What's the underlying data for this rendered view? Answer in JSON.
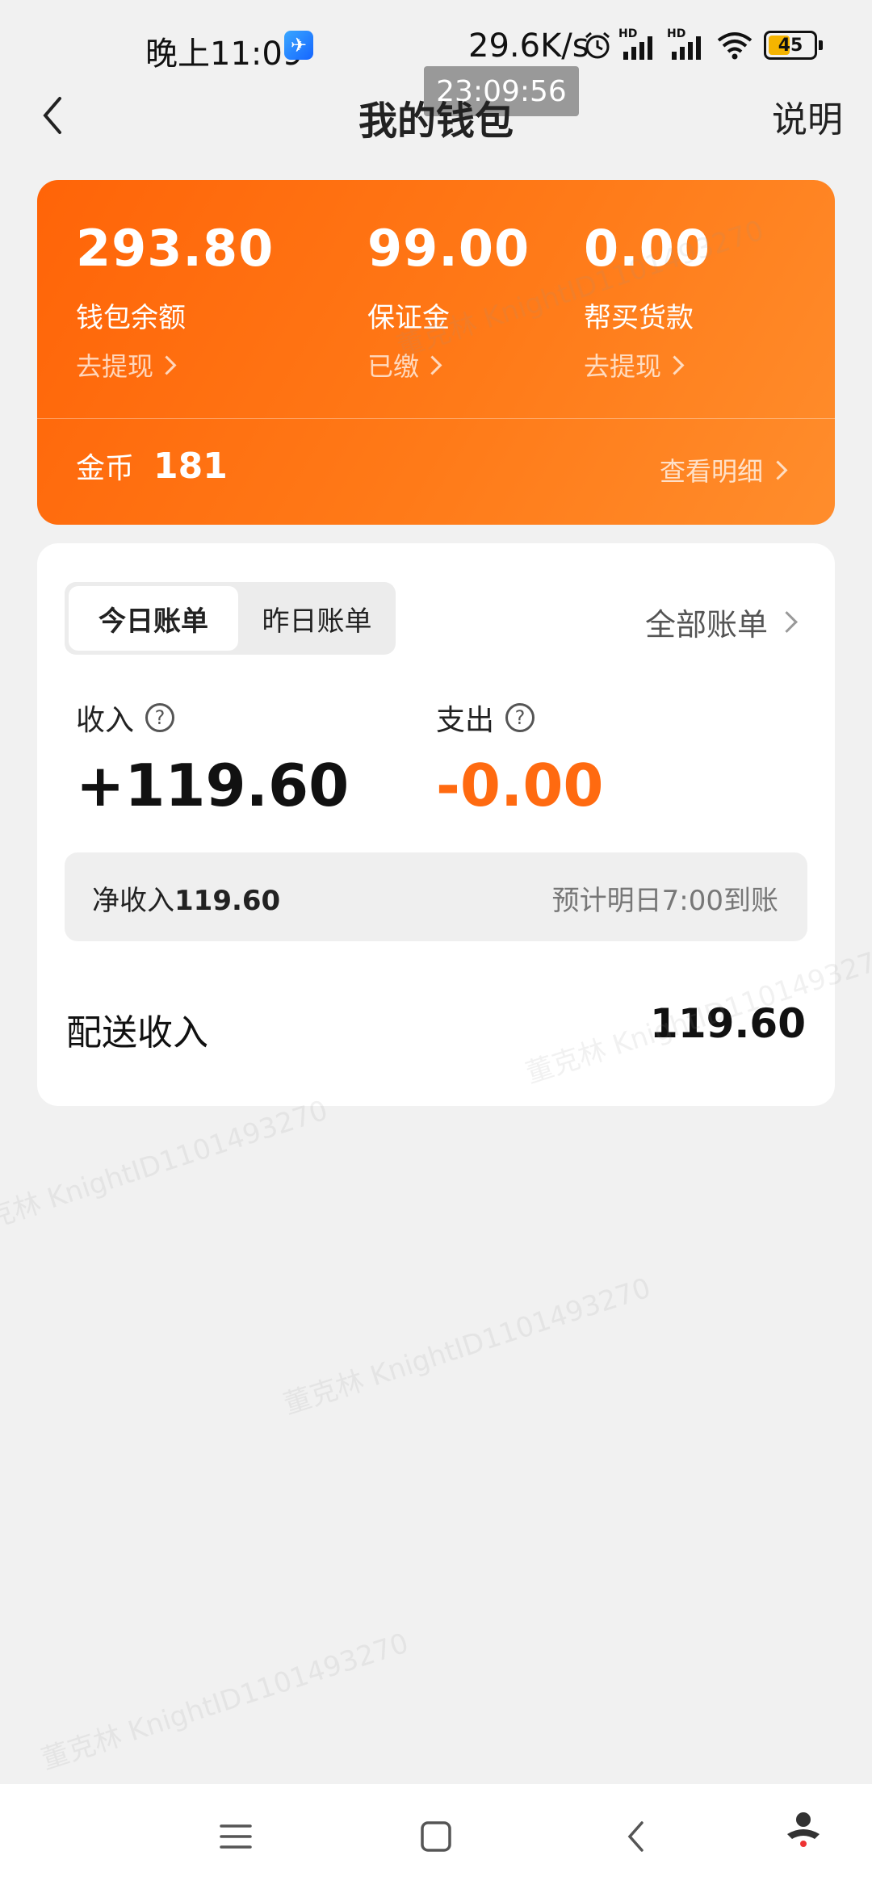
{
  "status_bar": {
    "time": "晚上11:09",
    "net_speed": "29.6K/s",
    "hd1": "HD",
    "hd2": "HD",
    "battery": "45",
    "clock_overlay": "23:09:56"
  },
  "header": {
    "title": "我的钱包",
    "help_label": "说明"
  },
  "wallet": {
    "items": [
      {
        "amount": "293.80",
        "label": "钱包余额",
        "action": "去提现"
      },
      {
        "amount": "99.00",
        "label": "保证金",
        "action": "已缴"
      },
      {
        "amount": "0.00",
        "label": "帮买货款",
        "action": "去提现"
      }
    ],
    "coin_label": "金币",
    "coin_value": "181",
    "detail_link": "查看明细"
  },
  "bills": {
    "tabs": [
      "今日账单",
      "昨日账单"
    ],
    "active_tab": "今日账单",
    "all_bills_link": "全部账单",
    "income_label": "收入",
    "income_value": "+119.60",
    "expense_label": "支出",
    "expense_value": "-0.00",
    "net_income_label": "净收入",
    "net_income_value": "119.60",
    "eta_text": "预计明日7:00到账",
    "rows": [
      {
        "label": "配送收入",
        "value": "119.60"
      }
    ]
  },
  "watermark": "董克林 KnightID1101493270",
  "colors": {
    "accent": "#ff6a10",
    "card_start": "#ff6408",
    "card_end": "#ff8d2c",
    "background": "#f1f1f1"
  }
}
